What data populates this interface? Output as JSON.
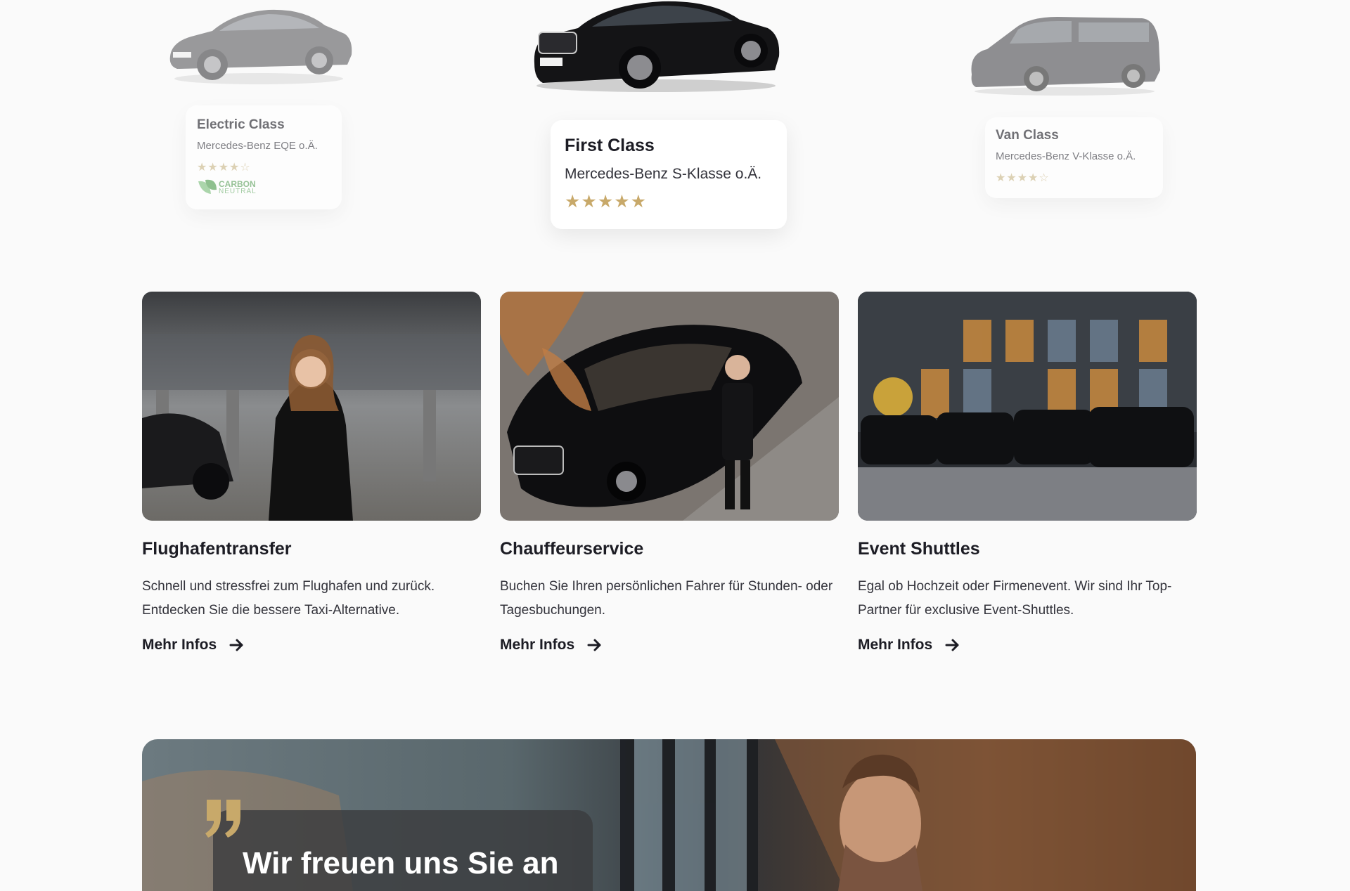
{
  "car_classes": [
    {
      "title": "Electric Class",
      "model": "Mercedes-Benz EQE o.Ä.",
      "stars": "★★★★☆",
      "badge": {
        "line1": "CARBON",
        "line2": "NEUTRAL",
        "icon": "leaf-icon"
      }
    },
    {
      "title": "First Class",
      "model": "Mercedes-Benz S-Klasse o.Ä.",
      "stars": "★★★★★"
    },
    {
      "title": "Van Class",
      "model": "Mercedes-Benz V-Klasse o.Ä.",
      "stars": "★★★★☆"
    }
  ],
  "services": [
    {
      "title": "Flughafentransfer",
      "text": "Schnell und stressfrei zum Flughafen und zurück. Entdecken Sie die bessere Taxi-Alternative.",
      "link": "Mehr Infos"
    },
    {
      "title": "Chauffeurservice",
      "text": "Buchen Sie Ihren persönlichen Fahrer für Stunden- oder Tagesbuchungen.",
      "link": "Mehr Infos"
    },
    {
      "title": "Event Shuttles",
      "text": "Egal ob Hochzeit oder Firmenevent. Wir sind Ihr Top-Partner für exclusive Event-Shuttles.",
      "link": "Mehr Infos"
    }
  ],
  "testimonial": {
    "heading": "Wir freuen uns Sie an"
  },
  "colors": {
    "accent_gold": "#c8a96a",
    "text_dark": "#1c1c24",
    "background": "#fafafa",
    "carbon_green": "#5aa05a"
  }
}
